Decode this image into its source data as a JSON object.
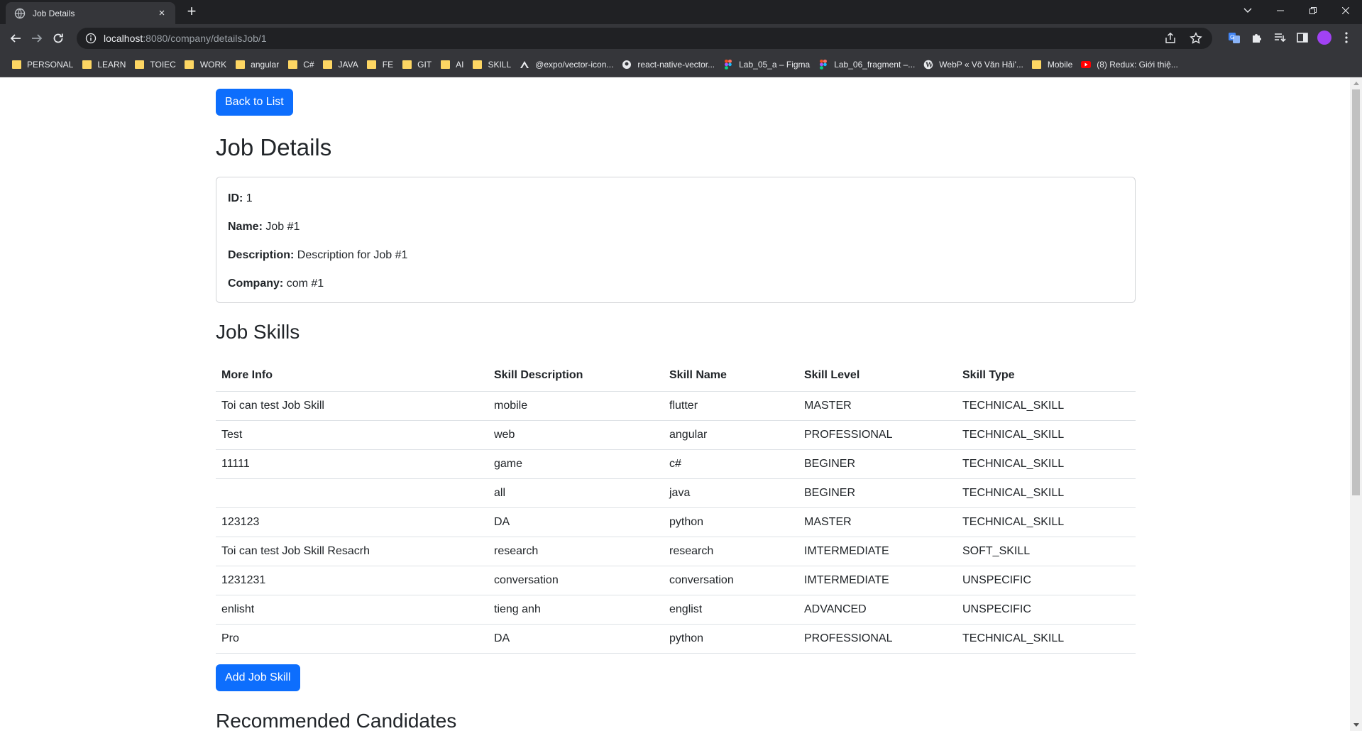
{
  "browser": {
    "tab_title": "Job Details",
    "tab_close": "×",
    "new_tab": "+",
    "url_host": "localhost",
    "url_path": ":8080/company/detailsJob/1",
    "bookmarks": [
      {
        "label": "PERSONAL",
        "icon": "folder-icon"
      },
      {
        "label": "LEARN",
        "icon": "folder-icon"
      },
      {
        "label": "TOIEC",
        "icon": "folder-icon"
      },
      {
        "label": "WORK",
        "icon": "folder-icon"
      },
      {
        "label": "angular",
        "icon": "folder-icon"
      },
      {
        "label": "C#",
        "icon": "folder-icon"
      },
      {
        "label": "JAVA",
        "icon": "folder-icon"
      },
      {
        "label": "FE",
        "icon": "folder-icon"
      },
      {
        "label": "GIT",
        "icon": "folder-icon"
      },
      {
        "label": "AI",
        "icon": "folder-icon"
      },
      {
        "label": "SKILL",
        "icon": "folder-icon"
      },
      {
        "label": "@expo/vector-icon...",
        "icon": "expo-icon"
      },
      {
        "label": "react-native-vector...",
        "icon": "github-icon"
      },
      {
        "label": "Lab_05_a – Figma",
        "icon": "figma-icon"
      },
      {
        "label": "Lab_06_fragment –...",
        "icon": "figma-icon"
      },
      {
        "label": "WebP « Võ Văn Hải'...",
        "icon": "wordpress-icon"
      },
      {
        "label": "Mobile",
        "icon": "folder-icon"
      },
      {
        "label": "(8) Redux: Giới thiệ...",
        "icon": "youtube-icon"
      }
    ]
  },
  "page": {
    "back_button": "Back to List",
    "title": "Job Details",
    "details": [
      {
        "label": "ID:",
        "value": "1"
      },
      {
        "label": "Name:",
        "value": "Job #1"
      },
      {
        "label": "Description:",
        "value": "Description for Job #1"
      },
      {
        "label": "Company:",
        "value": "com #1"
      }
    ],
    "skills_title": "Job Skills",
    "skills_columns": [
      "More Info",
      "Skill Description",
      "Skill Name",
      "Skill Level",
      "Skill Type"
    ],
    "skills_rows": [
      [
        "Toi can test Job Skill",
        "mobile",
        "flutter",
        "MASTER",
        "TECHNICAL_SKILL"
      ],
      [
        "Test",
        "web",
        "angular",
        "PROFESSIONAL",
        "TECHNICAL_SKILL"
      ],
      [
        "11111",
        "game",
        "c#",
        "BEGINER",
        "TECHNICAL_SKILL"
      ],
      [
        "",
        "all",
        "java",
        "BEGINER",
        "TECHNICAL_SKILL"
      ],
      [
        "123123",
        "DA",
        "python",
        "MASTER",
        "TECHNICAL_SKILL"
      ],
      [
        "Toi can test Job Skill Resacrh",
        "research",
        "research",
        "IMTERMEDIATE",
        "SOFT_SKILL"
      ],
      [
        "1231231",
        "conversation",
        "conversation",
        "IMTERMEDIATE",
        "UNSPECIFIC"
      ],
      [
        "enlisht",
        "tieng anh",
        "englist",
        "ADVANCED",
        "UNSPECIFIC"
      ],
      [
        "Pro",
        "DA",
        "python",
        "PROFESSIONAL",
        "TECHNICAL_SKILL"
      ]
    ],
    "add_button": "Add Job Skill",
    "candidates_title": "Recommended Candidates"
  },
  "colors": {
    "primary": "#0d6efd",
    "chrome_dark": "#202124",
    "chrome_toolbar": "#35363a",
    "folder": "#fdd663"
  }
}
